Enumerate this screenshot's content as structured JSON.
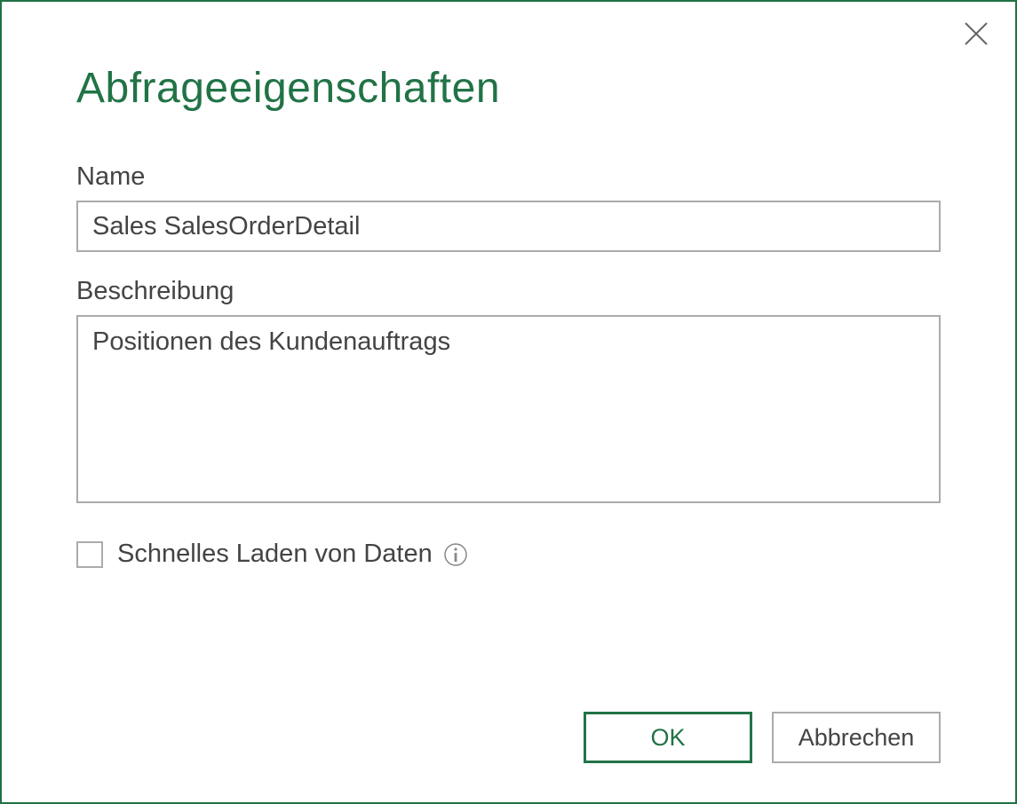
{
  "dialog": {
    "title": "Abfrageeigenschaften",
    "fields": {
      "name": {
        "label": "Name",
        "value": "Sales SalesOrderDetail"
      },
      "description": {
        "label": "Beschreibung",
        "value": "Positionen des Kundenauftrags"
      },
      "fast_load": {
        "label": "Schnelles Laden von Daten",
        "checked": false
      }
    },
    "buttons": {
      "ok": "OK",
      "cancel": "Abbrechen"
    }
  },
  "colors": {
    "brand": "#217346",
    "border": "#ababab",
    "text": "#444444"
  }
}
